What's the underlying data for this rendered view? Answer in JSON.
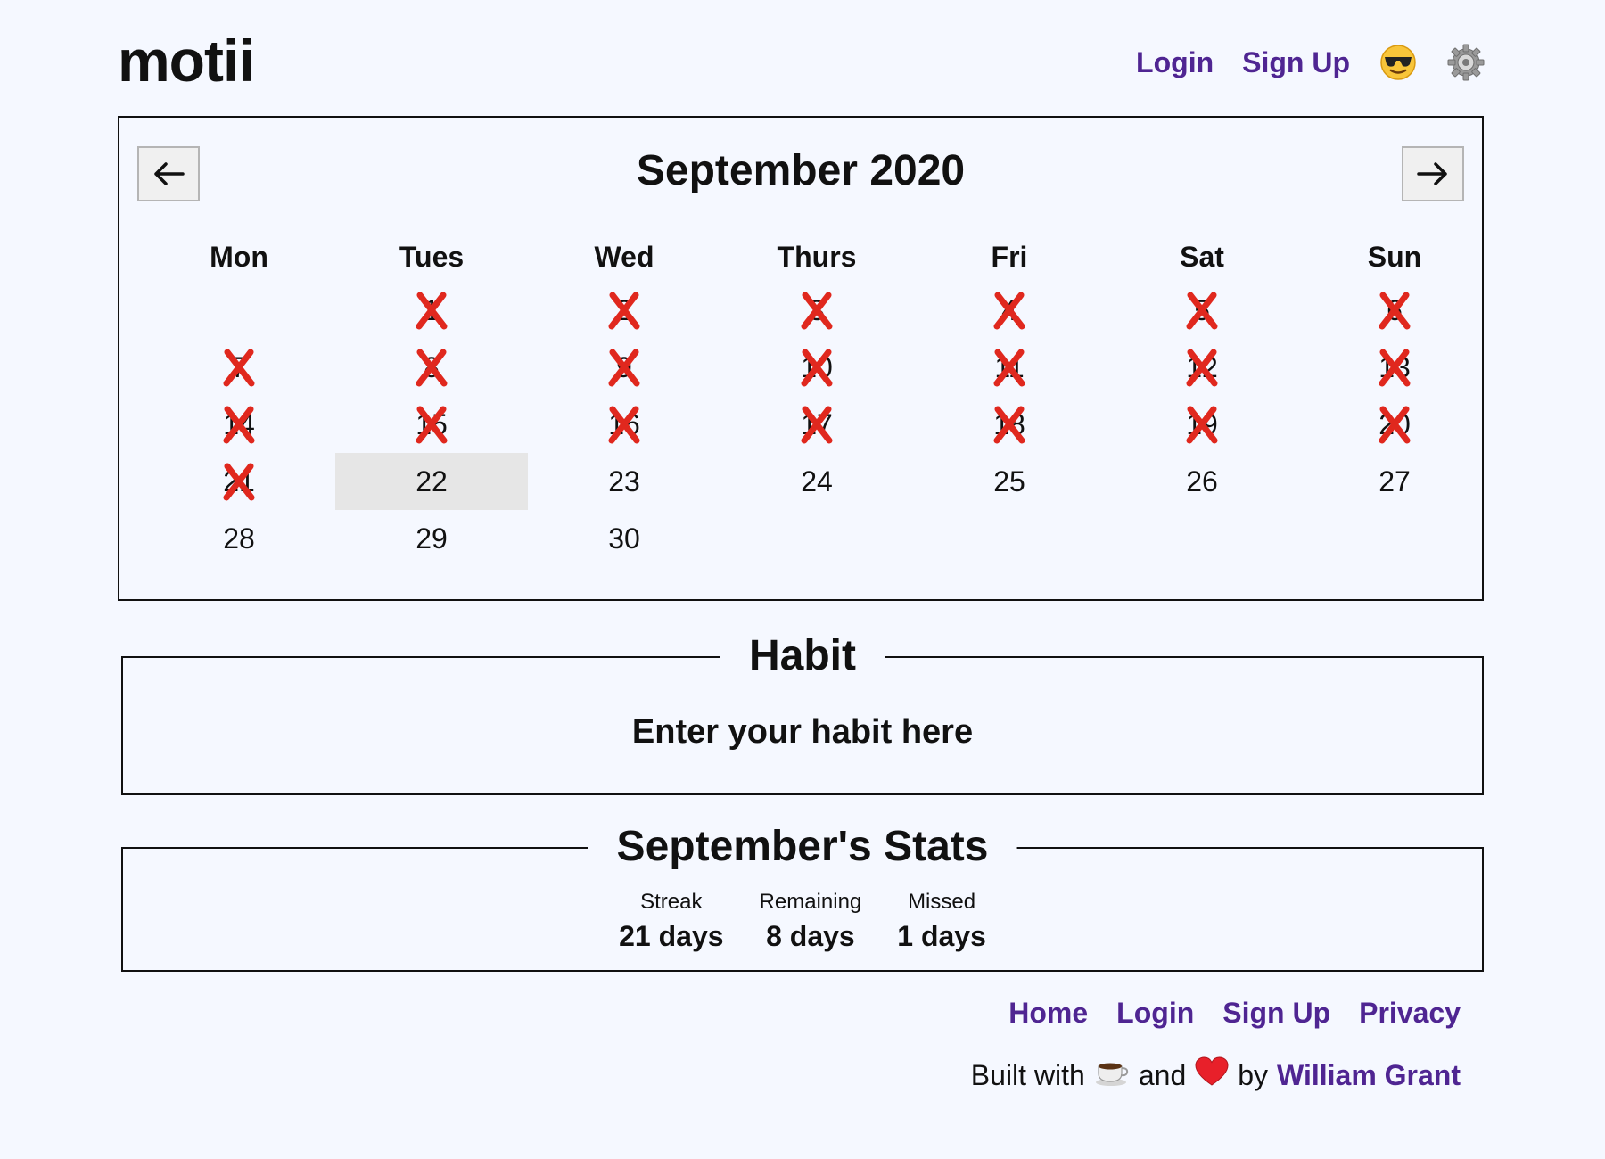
{
  "brand": {
    "logo": "motii"
  },
  "nav": {
    "login": "Login",
    "signup": "Sign Up",
    "theme_icon": "sunglasses-emoji-icon",
    "settings_icon": "gear-icon"
  },
  "calendar": {
    "title": "September 2020",
    "prev_icon": "arrow-left-icon",
    "next_icon": "arrow-right-icon",
    "weekdays": [
      "Mon",
      "Tues",
      "Wed",
      "Thurs",
      "Fri",
      "Sat",
      "Sun"
    ],
    "days": [
      {
        "label": "",
        "missed": false
      },
      {
        "label": "1",
        "missed": true
      },
      {
        "label": "2",
        "missed": true
      },
      {
        "label": "3",
        "missed": true
      },
      {
        "label": "4",
        "missed": true
      },
      {
        "label": "5",
        "missed": true
      },
      {
        "label": "6",
        "missed": true
      },
      {
        "label": "7",
        "missed": true
      },
      {
        "label": "8",
        "missed": true
      },
      {
        "label": "9",
        "missed": true
      },
      {
        "label": "10",
        "missed": true
      },
      {
        "label": "11",
        "missed": true
      },
      {
        "label": "12",
        "missed": true
      },
      {
        "label": "13",
        "missed": true
      },
      {
        "label": "14",
        "missed": true
      },
      {
        "label": "15",
        "missed": true
      },
      {
        "label": "16",
        "missed": true
      },
      {
        "label": "17",
        "missed": true
      },
      {
        "label": "18",
        "missed": true
      },
      {
        "label": "19",
        "missed": true
      },
      {
        "label": "20",
        "missed": true
      },
      {
        "label": "21",
        "missed": true
      },
      {
        "label": "22",
        "missed": false,
        "today": true
      },
      {
        "label": "23",
        "missed": false
      },
      {
        "label": "24",
        "missed": false
      },
      {
        "label": "25",
        "missed": false
      },
      {
        "label": "26",
        "missed": false
      },
      {
        "label": "27",
        "missed": false
      },
      {
        "label": "28",
        "missed": false
      },
      {
        "label": "29",
        "missed": false
      },
      {
        "label": "30",
        "missed": false
      }
    ],
    "mark_color": "#e0281e"
  },
  "habit": {
    "legend": "Habit",
    "placeholder": "Enter your habit here"
  },
  "stats": {
    "legend": "September's Stats",
    "items": [
      {
        "label": "Streak",
        "value": "21 days"
      },
      {
        "label": "Remaining",
        "value": "8 days"
      },
      {
        "label": "Missed",
        "value": "1 days"
      }
    ]
  },
  "footer": {
    "links": [
      "Home",
      "Login",
      "Sign Up",
      "Privacy"
    ],
    "credit_prefix": "Built with",
    "credit_coffee_icon": "coffee-icon",
    "credit_and": "and",
    "credit_heart_icon": "heart-icon",
    "credit_by": "by",
    "author": "William Grant"
  },
  "colors": {
    "link": "#4f2592",
    "background": "#f5f8ff",
    "today_bg": "#e6e6e6"
  }
}
